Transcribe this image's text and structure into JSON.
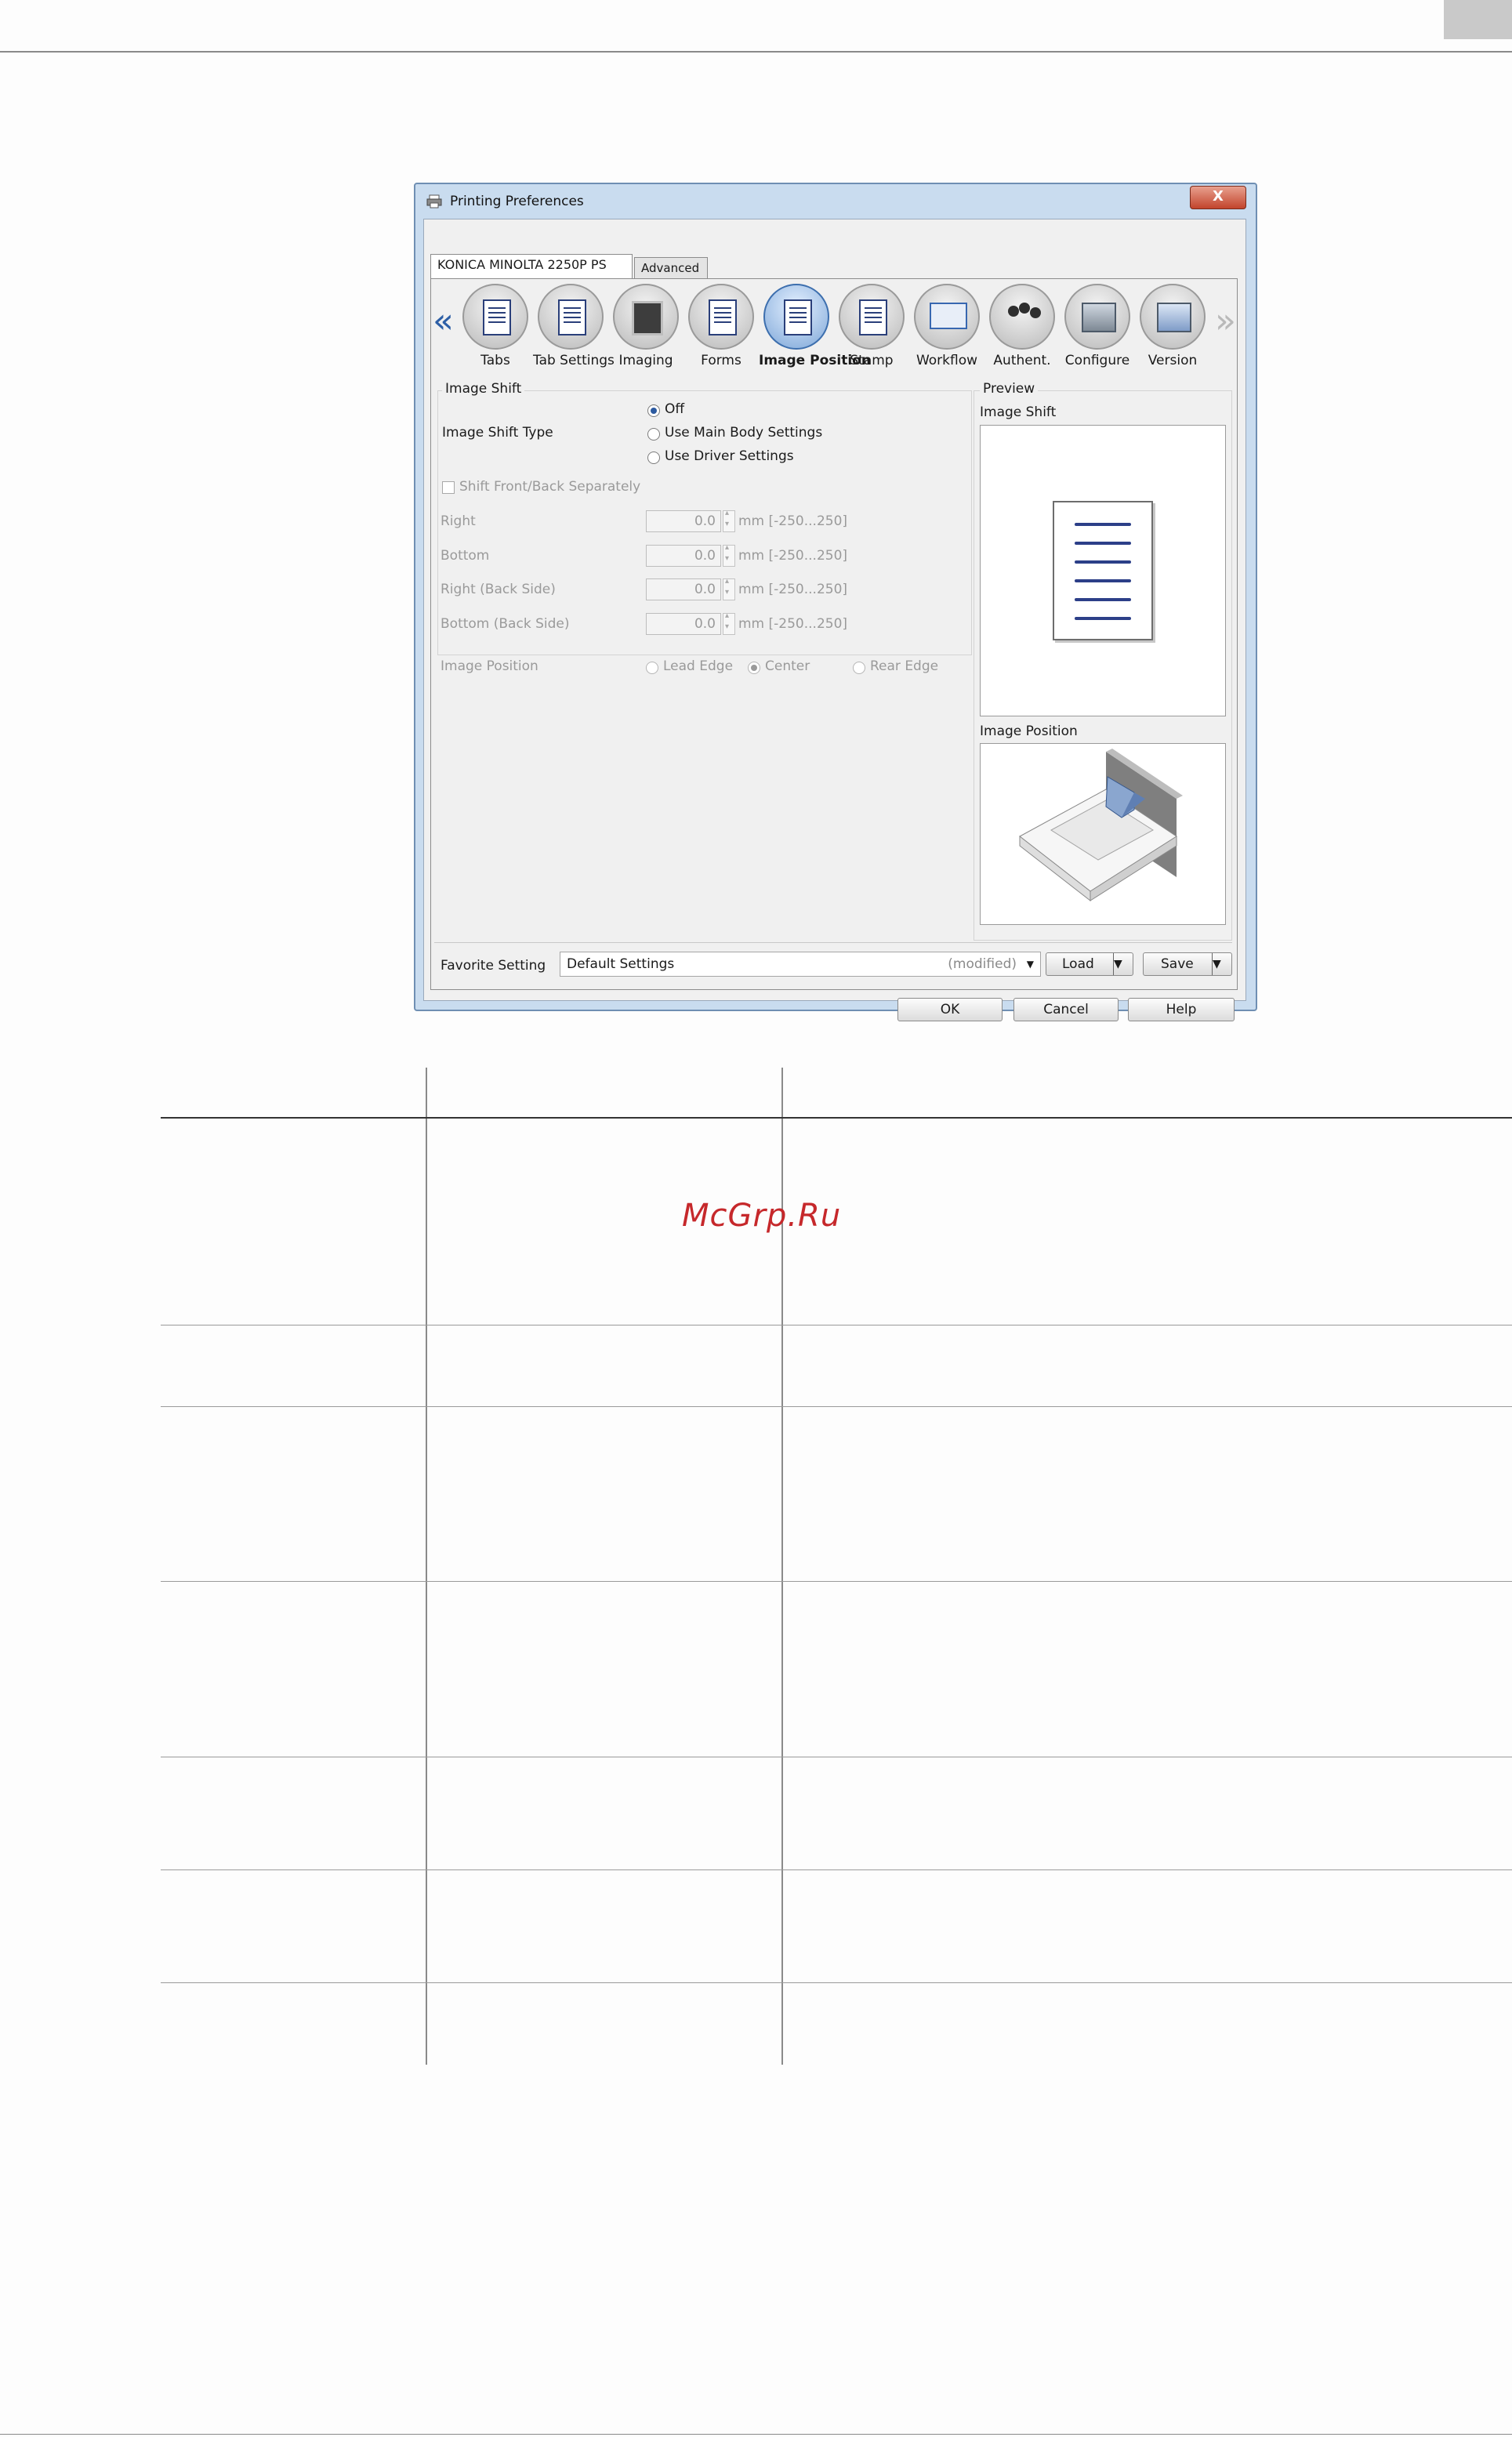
{
  "dialog": {
    "title": "Printing Preferences",
    "close_label": "X",
    "tabs": [
      {
        "label": "KONICA MINOLTA 2250P PS"
      },
      {
        "label": "Advanced"
      }
    ],
    "nav_prev": "«",
    "nav_next": "»",
    "toolbar": [
      {
        "label": "Tabs",
        "icon": "tabs-icon"
      },
      {
        "label": "Tab Settings",
        "icon": "tab-settings-icon"
      },
      {
        "label": "Imaging",
        "icon": "imaging-icon"
      },
      {
        "label": "Forms",
        "icon": "forms-icon"
      },
      {
        "label": "Image Position",
        "icon": "image-position-icon"
      },
      {
        "label": "Stamp",
        "icon": "stamp-icon"
      },
      {
        "label": "Workflow",
        "icon": "workflow-icon"
      },
      {
        "label": "Authent.",
        "icon": "authentication-icon"
      },
      {
        "label": "Configure",
        "icon": "configure-icon"
      },
      {
        "label": "Version",
        "icon": "version-icon"
      }
    ],
    "image_shift": {
      "group_label": "Image Shift",
      "type_label": "Image Shift Type",
      "options": [
        "Off",
        "Use Main Body Settings",
        "Use Driver Settings"
      ],
      "selected": "Off",
      "shift_separately_label": "Shift Front/Back Separately",
      "fields": [
        {
          "label": "Right",
          "value": "0.0",
          "unit": "mm [-250...250]"
        },
        {
          "label": "Bottom",
          "value": "0.0",
          "unit": "mm [-250...250]"
        },
        {
          "label": "Right (Back Side)",
          "value": "0.0",
          "unit": "mm [-250...250]"
        },
        {
          "label": "Bottom (Back Side)",
          "value": "0.0",
          "unit": "mm [-250...250]"
        }
      ]
    },
    "image_position": {
      "label": "Image Position",
      "options": [
        "Lead Edge",
        "Center",
        "Rear Edge"
      ],
      "selected": "Center"
    },
    "preview": {
      "group_label": "Preview",
      "image_shift_label": "Image Shift",
      "image_position_label": "Image Position"
    },
    "favorite": {
      "label": "Favorite Setting",
      "value": "Default Settings",
      "status": "(modified)",
      "load_label": "Load",
      "save_label": "Save"
    },
    "buttons": {
      "ok": "OK",
      "cancel": "Cancel",
      "help": "Help"
    }
  },
  "watermark": "McGrp.Ru"
}
